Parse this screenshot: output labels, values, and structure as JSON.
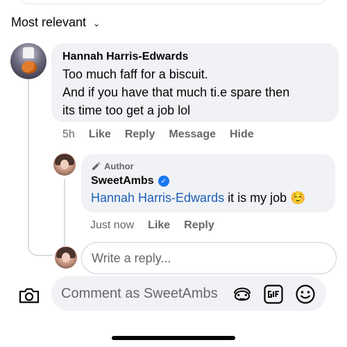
{
  "sort": {
    "label": "Most relevant"
  },
  "comment": {
    "author": "Hannah Harris-Edwards",
    "lines": [
      "Too much faff for a biscuit.",
      "And if you have that much ti.e spare then",
      "its time too get a job lol"
    ],
    "time": "5h",
    "actions": {
      "like": "Like",
      "reply": "Reply",
      "message": "Message",
      "hide": "Hide"
    }
  },
  "reply": {
    "badge": "Author",
    "author": "SweetAmbs",
    "mention": "Hannah Harris-Edwards",
    "text": " it is my job ☺️",
    "time": "Just now",
    "actions": {
      "like": "Like",
      "reply": "Reply"
    }
  },
  "reply_box": {
    "placeholder": "Write a reply..."
  },
  "composer": {
    "placeholder": "Comment as SweetAmbs"
  },
  "icons": {
    "sort": "chevron-down-icon",
    "author_badge": "pencil-icon",
    "verified": "verified-badge-icon",
    "camera": "camera-icon",
    "avatar_sticker": "avatar-sticker-icon",
    "gif": "gif-icon",
    "emoji": "emoji-icon"
  },
  "colors": {
    "mention": "#1b5fb6",
    "verified": "#1877f2",
    "bubble": "#f0f2f5",
    "secondary_text": "#65676b"
  }
}
